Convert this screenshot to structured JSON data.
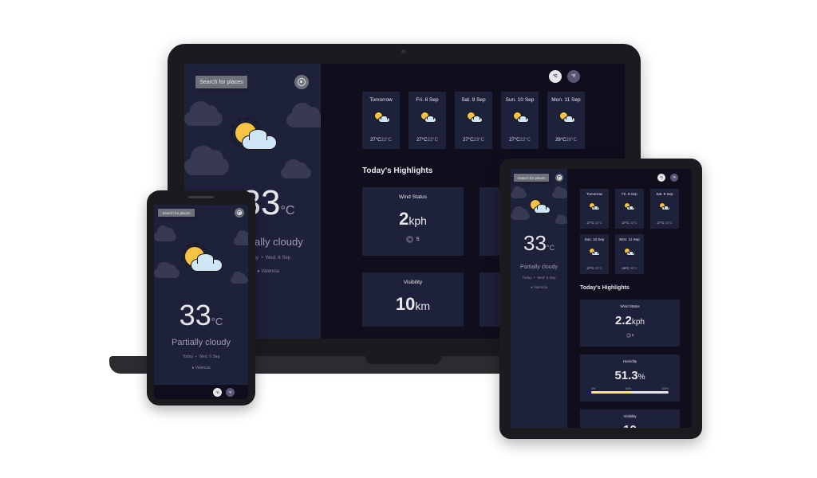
{
  "app": {
    "search_label": "Search for places",
    "location_icon": "crosshair-icon",
    "unit_c": "°C",
    "unit_f": "°F"
  },
  "current": {
    "temp": "33",
    "temp_unit": "°C",
    "condition": "Partially cloudy",
    "date_today": "Today",
    "date_sep": "•",
    "date": "Wed. 6 Sep",
    "location": "Valencia",
    "icon": "sun-cloud-icon"
  },
  "forecast": [
    {
      "day": "Tomorrow",
      "max": "27°C",
      "min": "22°C"
    },
    {
      "day": "Fri. 8 Sep",
      "max": "27°C",
      "min": "22°C"
    },
    {
      "day": "Sat. 9 Sep",
      "max": "27°C",
      "min": "23°C"
    },
    {
      "day": "Sun. 10 Sep",
      "max": "27°C",
      "min": "22°C"
    },
    {
      "day": "Mon. 11 Sep",
      "max": "29°C",
      "min": "20°C"
    }
  ],
  "highlights": {
    "title": "Today's Highlights",
    "wind": {
      "label": "Wind Status",
      "value": "2",
      "unit": "kph",
      "dir": "S"
    },
    "visibility": {
      "label": "Visibility",
      "value": "10",
      "unit": "km"
    },
    "humidity": {
      "label": "Humidity",
      "value": "51.3",
      "unit": "%",
      "p0": "0%",
      "p50": "50%",
      "p100": "100%",
      "level": 51.3
    }
  },
  "tablet": {
    "wind_value": "2.2",
    "wind_unit": "kph",
    "vis_value": "10"
  },
  "colors": {
    "sidebar": "#1e213a",
    "main": "#100e1d",
    "text": "#e7e7eb",
    "muted": "#a09fb1",
    "progress": "#ffec65"
  }
}
